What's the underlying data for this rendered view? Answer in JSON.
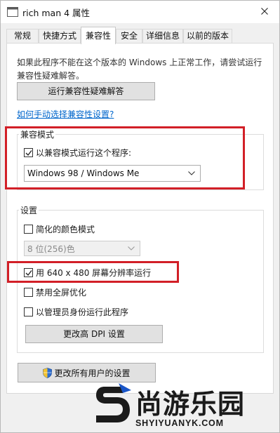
{
  "window": {
    "title": "rich man 4 属性",
    "close_glyph": "✕"
  },
  "tabs": [
    {
      "label": "常规"
    },
    {
      "label": "快捷方式"
    },
    {
      "label": "兼容性"
    },
    {
      "label": "安全"
    },
    {
      "label": "详细信息"
    },
    {
      "label": "以前的版本"
    }
  ],
  "compat": {
    "intro": "如果此程序不能在这个版本的 Windows 上正常工作，请尝试运行兼容性疑难解答。",
    "troubleshoot_button": "运行兼容性疑难解答",
    "manual_link": "如何手动选择兼容性设置?",
    "mode_group": {
      "label": "兼容模式",
      "checkbox_label": "以兼容模式运行这个程序:",
      "checked": true,
      "selected_os": "Windows 98 / Windows Me"
    },
    "settings_group": {
      "label": "设置",
      "reduced_color_label": "简化的颜色模式",
      "reduced_color_checked": false,
      "color_depth_value": "8 位(256)色",
      "res640_label": "用 640 x 480 屏幕分辨率运行",
      "res640_checked": true,
      "fullscreen_opt_label": "禁用全屏优化",
      "fullscreen_opt_checked": false,
      "admin_label": "以管理员身份运行此程序",
      "admin_checked": false,
      "dpi_button": "更改高 DPI 设置"
    },
    "all_users_button": "更改所有用户的设置"
  },
  "watermark": {
    "brand": "尚游乐园",
    "url": "SHYIYUANYK.COM"
  },
  "colors": {
    "highlight": "#d21f27",
    "link": "#0066cc",
    "brand_blue": "#1a56c8"
  }
}
